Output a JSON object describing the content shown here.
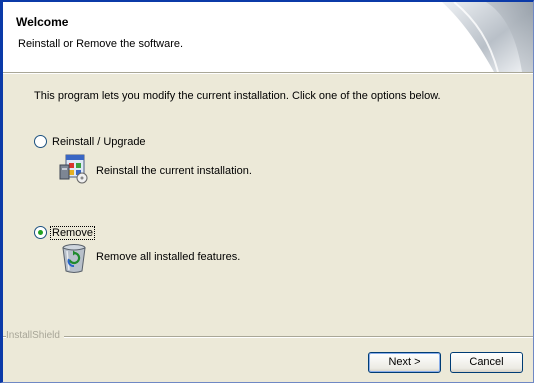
{
  "header": {
    "title": "Welcome",
    "subtitle": "Reinstall or Remove the software."
  },
  "intro": "This program lets you modify the current installation. Click one of the options below.",
  "options": [
    {
      "label": "Reinstall / Upgrade",
      "description": "Reinstall the current installation.",
      "selected": false,
      "icon": "reinstall-program-icon"
    },
    {
      "label": "Remove",
      "description": "Remove all installed features.",
      "selected": true,
      "icon": "recycle-bin-icon"
    }
  ],
  "brand": "InstallShield",
  "buttons": {
    "next": "Next >",
    "cancel": "Cancel"
  },
  "colors": {
    "dialog_bg": "#ece9d8",
    "border_blue": "#0b3aa8",
    "radio_dot": "#21a121"
  }
}
